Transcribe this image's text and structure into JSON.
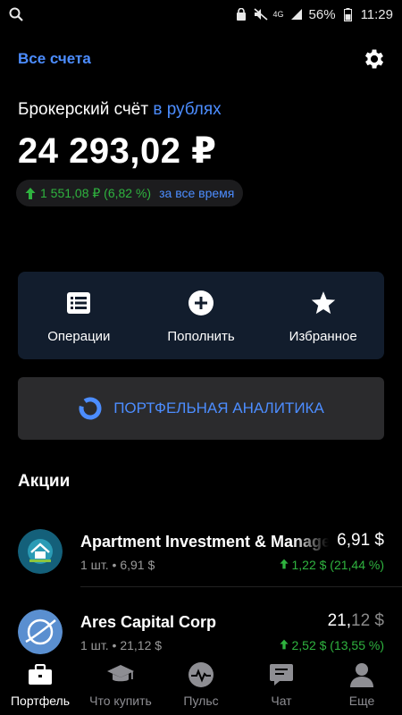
{
  "status_bar": {
    "battery": "56%",
    "time": "11:29",
    "network": "4G"
  },
  "header": {
    "all_accounts": "Все счета"
  },
  "account": {
    "title": "Брокерский счёт",
    "currency": "в рублях",
    "balance": "24 293,02 ₽",
    "gain": "1 551,08 ₽ (6,82 %)",
    "gain_period": "за все время"
  },
  "actions": [
    {
      "label": "Операции",
      "icon": "list-icon"
    },
    {
      "label": "Пополнить",
      "icon": "plus-circle-icon"
    },
    {
      "label": "Избранное",
      "icon": "star-icon"
    }
  ],
  "analytics": {
    "label": "ПОРТФЕЛЬНАЯ АНАЛИТИКА"
  },
  "section": {
    "title": "Акции"
  },
  "stocks": [
    {
      "name": "Apartment Investment & Management",
      "qty": "1 шт. • 6,91 $",
      "price_main": "6,91 $",
      "price_dim": "",
      "change": "1,22 $ (21,44 %)"
    },
    {
      "name": "Ares Capital Corp",
      "qty": "1 шт. • 21,12 $",
      "price_main": "21,",
      "price_dim": "12 $",
      "change": "2,52 $ (13,55 %)"
    }
  ],
  "nav": [
    {
      "label": "Портфель",
      "icon": "briefcase-icon",
      "active": true
    },
    {
      "label": "Что купить",
      "icon": "graduation-cap-icon",
      "active": false
    },
    {
      "label": "Пульс",
      "icon": "pulse-icon",
      "active": false
    },
    {
      "label": "Чат",
      "icon": "chat-icon",
      "active": false
    },
    {
      "label": "Еще",
      "icon": "profile-icon",
      "active": false
    }
  ],
  "colors": {
    "accent": "#4c8dff",
    "gain": "#2fb33f",
    "card": "#121d2d"
  }
}
